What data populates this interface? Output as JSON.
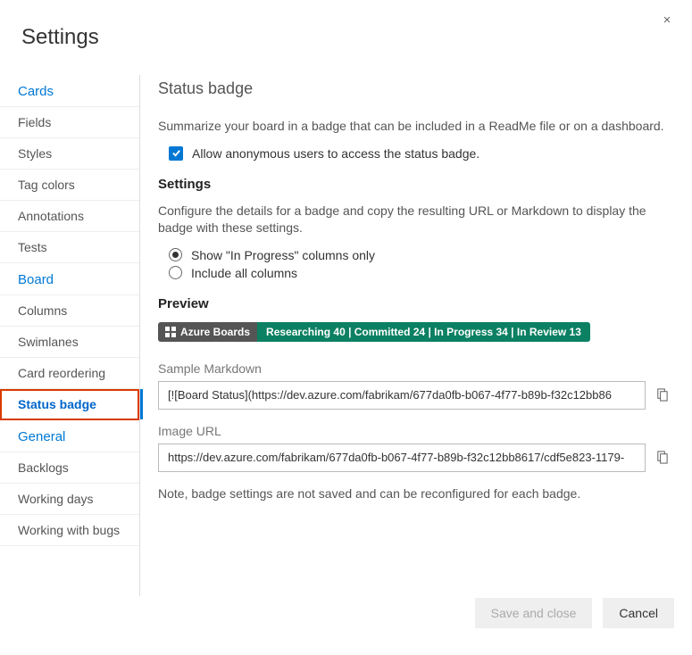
{
  "dialog": {
    "title": "Settings",
    "close_icon": "×"
  },
  "sidebar": {
    "sections": [
      {
        "header": "Cards",
        "items": [
          "Fields",
          "Styles",
          "Tag colors",
          "Annotations",
          "Tests"
        ]
      },
      {
        "header": "Board",
        "items": [
          "Columns",
          "Swimlanes",
          "Card reordering",
          "Status badge"
        ],
        "selected": "Status badge"
      },
      {
        "header": "General",
        "items": [
          "Backlogs",
          "Working days",
          "Working with bugs"
        ]
      }
    ]
  },
  "main": {
    "title": "Status badge",
    "description": "Summarize your board in a badge that can be included in a ReadMe file or on a dashboard.",
    "allow_anonymous": {
      "checked": true,
      "label": "Allow anonymous users to access the status badge."
    },
    "settings_heading": "Settings",
    "settings_desc": "Configure the details for a badge and copy the resulting URL or Markdown to display the badge with these settings.",
    "columns_option": {
      "options": [
        "Show \"In Progress\" columns only",
        "Include all columns"
      ],
      "selected_index": 0
    },
    "preview_heading": "Preview",
    "badge": {
      "left_label": "Azure Boards",
      "right_label": "Researching 40 | Committed 24 | In Progress 34 | In Review 13"
    },
    "markdown": {
      "label": "Sample Markdown",
      "value": "[![Board Status](https://dev.azure.com/fabrikam/677da0fb-b067-4f77-b89b-f32c12bb86"
    },
    "image_url": {
      "label": "Image URL",
      "value": "https://dev.azure.com/fabrikam/677da0fb-b067-4f77-b89b-f32c12bb8617/cdf5e823-1179-"
    },
    "note": "Note, badge settings are not saved and can be reconfigured for each badge."
  },
  "footer": {
    "save_label": "Save and close",
    "cancel_label": "Cancel"
  }
}
